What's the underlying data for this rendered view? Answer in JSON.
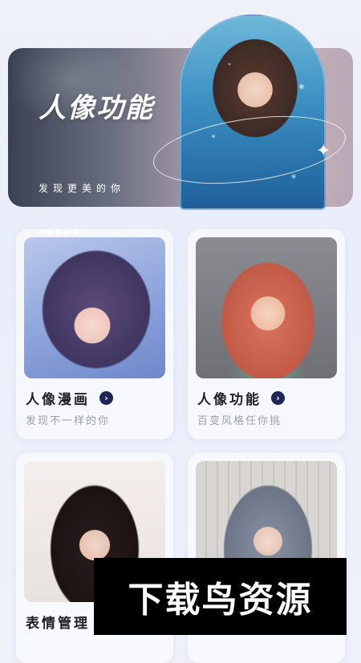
{
  "banner": {
    "title": "人像功能",
    "subtitle": "发现更美的你"
  },
  "cards": [
    {
      "title": "人像漫画",
      "subtitle": "发现不一样的你",
      "image": "anime-girl-portrait"
    },
    {
      "title": "人像功能",
      "subtitle": "百变风格任你挑",
      "image": "cartoon-redhead-portrait"
    },
    {
      "title": "表情管理",
      "subtitle": "",
      "image": "realistic-portrait-dark-hair"
    },
    {
      "title": "",
      "subtitle": "",
      "image": "realistic-portrait-gray-hair"
    }
  ],
  "icons": {
    "chevron": "›",
    "sparkle": "✦"
  },
  "watermark": {
    "text": "下载鸟资源"
  }
}
